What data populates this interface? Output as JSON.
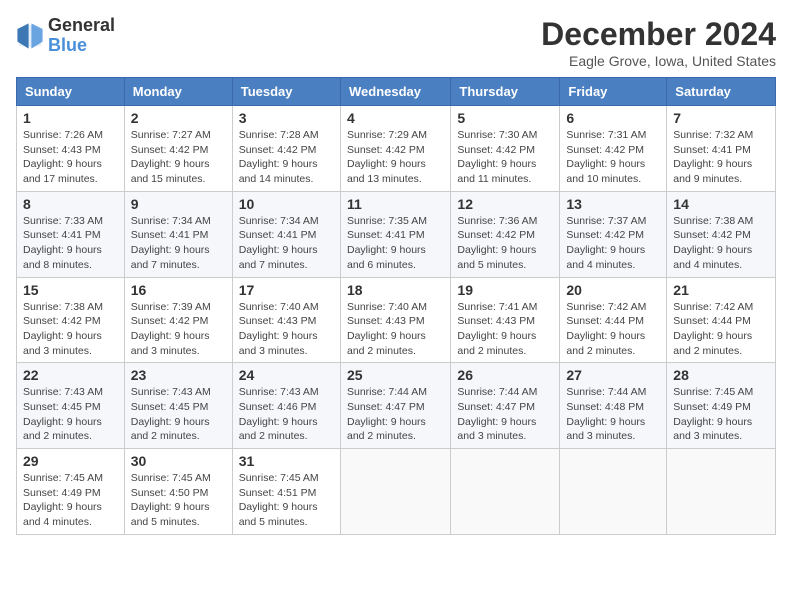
{
  "logo": {
    "general": "General",
    "blue": "Blue"
  },
  "title": "December 2024",
  "location": "Eagle Grove, Iowa, United States",
  "days_header": [
    "Sunday",
    "Monday",
    "Tuesday",
    "Wednesday",
    "Thursday",
    "Friday",
    "Saturday"
  ],
  "weeks": [
    [
      {
        "day": "1",
        "sunrise": "7:26 AM",
        "sunset": "4:43 PM",
        "daylight": "9 hours and 17 minutes."
      },
      {
        "day": "2",
        "sunrise": "7:27 AM",
        "sunset": "4:42 PM",
        "daylight": "9 hours and 15 minutes."
      },
      {
        "day": "3",
        "sunrise": "7:28 AM",
        "sunset": "4:42 PM",
        "daylight": "9 hours and 14 minutes."
      },
      {
        "day": "4",
        "sunrise": "7:29 AM",
        "sunset": "4:42 PM",
        "daylight": "9 hours and 13 minutes."
      },
      {
        "day": "5",
        "sunrise": "7:30 AM",
        "sunset": "4:42 PM",
        "daylight": "9 hours and 11 minutes."
      },
      {
        "day": "6",
        "sunrise": "7:31 AM",
        "sunset": "4:42 PM",
        "daylight": "9 hours and 10 minutes."
      },
      {
        "day": "7",
        "sunrise": "7:32 AM",
        "sunset": "4:41 PM",
        "daylight": "9 hours and 9 minutes."
      }
    ],
    [
      {
        "day": "8",
        "sunrise": "7:33 AM",
        "sunset": "4:41 PM",
        "daylight": "9 hours and 8 minutes."
      },
      {
        "day": "9",
        "sunrise": "7:34 AM",
        "sunset": "4:41 PM",
        "daylight": "9 hours and 7 minutes."
      },
      {
        "day": "10",
        "sunrise": "7:34 AM",
        "sunset": "4:41 PM",
        "daylight": "9 hours and 7 minutes."
      },
      {
        "day": "11",
        "sunrise": "7:35 AM",
        "sunset": "4:41 PM",
        "daylight": "9 hours and 6 minutes."
      },
      {
        "day": "12",
        "sunrise": "7:36 AM",
        "sunset": "4:42 PM",
        "daylight": "9 hours and 5 minutes."
      },
      {
        "day": "13",
        "sunrise": "7:37 AM",
        "sunset": "4:42 PM",
        "daylight": "9 hours and 4 minutes."
      },
      {
        "day": "14",
        "sunrise": "7:38 AM",
        "sunset": "4:42 PM",
        "daylight": "9 hours and 4 minutes."
      }
    ],
    [
      {
        "day": "15",
        "sunrise": "7:38 AM",
        "sunset": "4:42 PM",
        "daylight": "9 hours and 3 minutes."
      },
      {
        "day": "16",
        "sunrise": "7:39 AM",
        "sunset": "4:42 PM",
        "daylight": "9 hours and 3 minutes."
      },
      {
        "day": "17",
        "sunrise": "7:40 AM",
        "sunset": "4:43 PM",
        "daylight": "9 hours and 3 minutes."
      },
      {
        "day": "18",
        "sunrise": "7:40 AM",
        "sunset": "4:43 PM",
        "daylight": "9 hours and 2 minutes."
      },
      {
        "day": "19",
        "sunrise": "7:41 AM",
        "sunset": "4:43 PM",
        "daylight": "9 hours and 2 minutes."
      },
      {
        "day": "20",
        "sunrise": "7:42 AM",
        "sunset": "4:44 PM",
        "daylight": "9 hours and 2 minutes."
      },
      {
        "day": "21",
        "sunrise": "7:42 AM",
        "sunset": "4:44 PM",
        "daylight": "9 hours and 2 minutes."
      }
    ],
    [
      {
        "day": "22",
        "sunrise": "7:43 AM",
        "sunset": "4:45 PM",
        "daylight": "9 hours and 2 minutes."
      },
      {
        "day": "23",
        "sunrise": "7:43 AM",
        "sunset": "4:45 PM",
        "daylight": "9 hours and 2 minutes."
      },
      {
        "day": "24",
        "sunrise": "7:43 AM",
        "sunset": "4:46 PM",
        "daylight": "9 hours and 2 minutes."
      },
      {
        "day": "25",
        "sunrise": "7:44 AM",
        "sunset": "4:47 PM",
        "daylight": "9 hours and 2 minutes."
      },
      {
        "day": "26",
        "sunrise": "7:44 AM",
        "sunset": "4:47 PM",
        "daylight": "9 hours and 3 minutes."
      },
      {
        "day": "27",
        "sunrise": "7:44 AM",
        "sunset": "4:48 PM",
        "daylight": "9 hours and 3 minutes."
      },
      {
        "day": "28",
        "sunrise": "7:45 AM",
        "sunset": "4:49 PM",
        "daylight": "9 hours and 3 minutes."
      }
    ],
    [
      {
        "day": "29",
        "sunrise": "7:45 AM",
        "sunset": "4:49 PM",
        "daylight": "9 hours and 4 minutes."
      },
      {
        "day": "30",
        "sunrise": "7:45 AM",
        "sunset": "4:50 PM",
        "daylight": "9 hours and 5 minutes."
      },
      {
        "day": "31",
        "sunrise": "7:45 AM",
        "sunset": "4:51 PM",
        "daylight": "9 hours and 5 minutes."
      },
      null,
      null,
      null,
      null
    ]
  ]
}
